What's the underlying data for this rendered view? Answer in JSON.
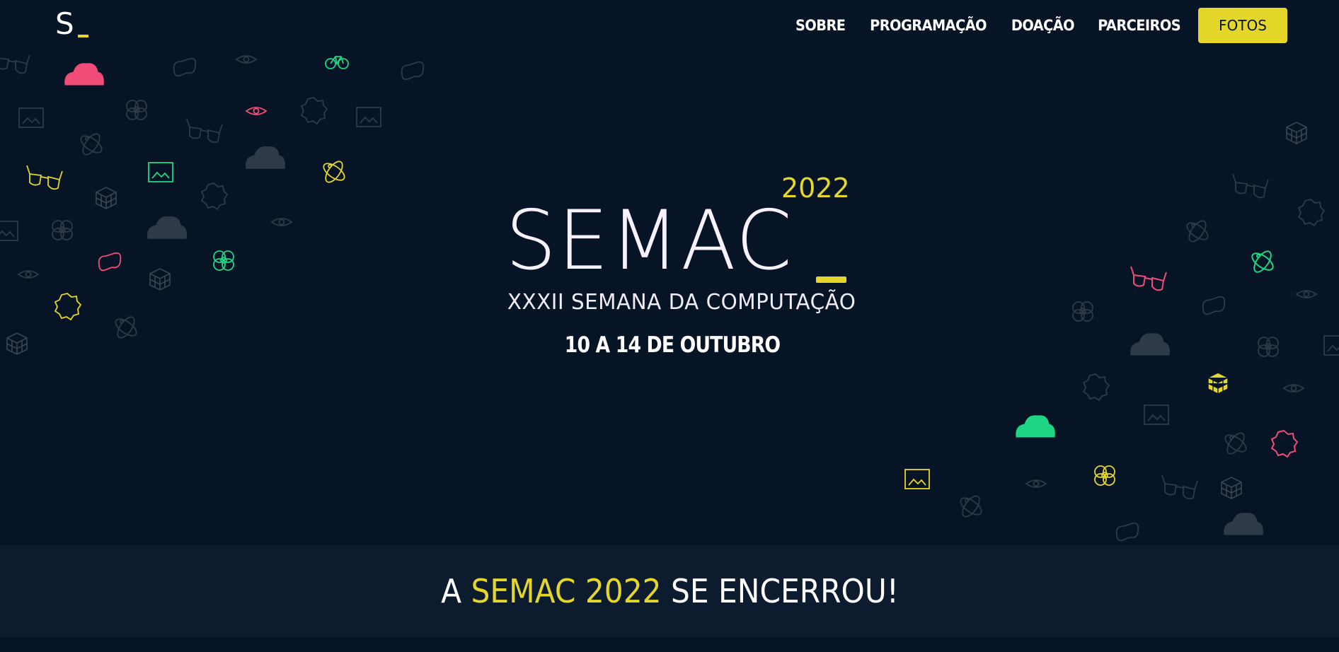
{
  "header": {
    "logo": {
      "letter": "S"
    },
    "nav": {
      "items": [
        {
          "label": "SOBRE"
        },
        {
          "label": "PROGRAMAÇÃO"
        },
        {
          "label": "DOAÇÃO"
        },
        {
          "label": "PARCEIROS"
        }
      ],
      "cta_label": "FOTOS"
    }
  },
  "hero": {
    "year": "2022",
    "title": "SEMAC",
    "subtitle": "XXXII SEMANA DA COMPUTAÇÃO",
    "dates": "10 A 14 DE OUTUBRO"
  },
  "banner": {
    "prefix": "A",
    "highlight": "SEMAC 2022",
    "suffix": "SE ENCERROU!"
  },
  "colors": {
    "background": "#061425",
    "band": "#0c1b2e",
    "accent_yellow": "#e4d72a",
    "accent_pink": "#f04c78",
    "accent_green": "#1ed584",
    "icon_muted": "#3a4452"
  },
  "decorative_icons": [
    "cloud-icon",
    "glasses-icon",
    "cube-icon",
    "atom-icon",
    "gear-icon",
    "image-icon",
    "eye-icon",
    "flower-icon",
    "bicycle-icon",
    "controller-icon"
  ]
}
